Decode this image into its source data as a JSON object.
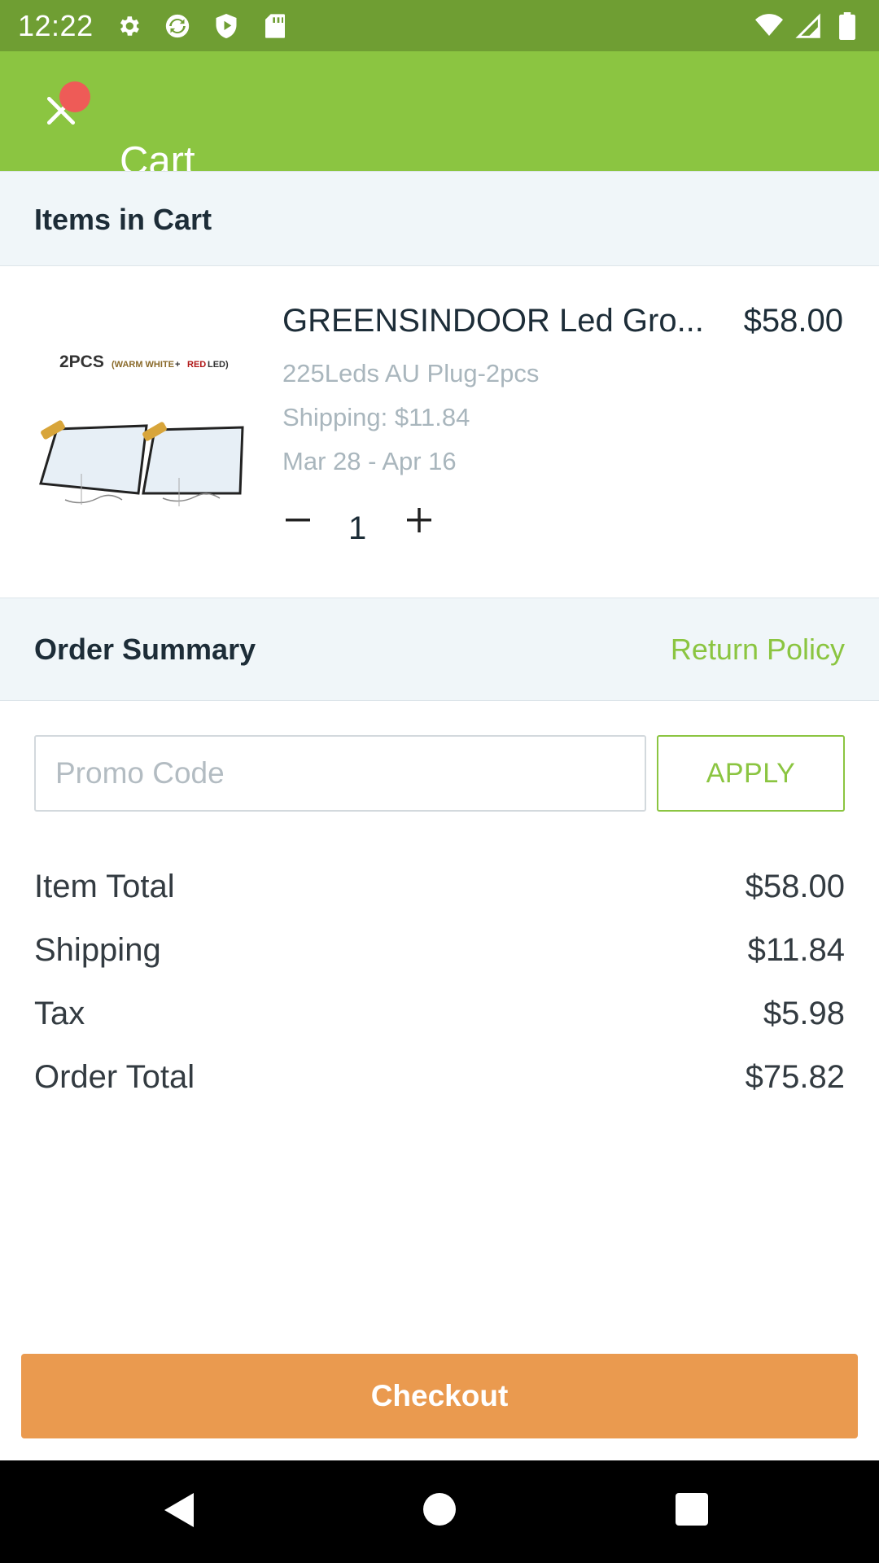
{
  "status_bar": {
    "time": "12:22",
    "left_icons": [
      "settings-icon",
      "sync-icon",
      "shield-icon",
      "sd-card-icon"
    ],
    "right_icons": [
      "wifi-icon",
      "signal-icon",
      "battery-icon"
    ]
  },
  "app_bar": {
    "title": "Cart",
    "close_icon": "close-icon"
  },
  "cart": {
    "section_title": "Items in Cart",
    "items": [
      {
        "name": "GREENSINDOOR Led Gro...",
        "price": "$58.00",
        "variant": "225Leds AU Plug-2pcs",
        "shipping": "Shipping: $11.84",
        "delivery": "Mar 28 - Apr 16",
        "quantity": "1",
        "image_caption_main": "2PCS",
        "image_caption_warm": "(WARM WHITE",
        "image_caption_plus": " + ",
        "image_caption_red": "RED",
        "image_caption_led": " LED)"
      }
    ]
  },
  "summary": {
    "title": "Order Summary",
    "return_policy": "Return Policy",
    "promo_placeholder": "Promo Code",
    "apply_label": "APPLY",
    "rows": [
      {
        "label": "Item Total",
        "value": "$58.00"
      },
      {
        "label": "Shipping",
        "value": "$11.84"
      },
      {
        "label": "Tax",
        "value": "$5.98"
      },
      {
        "label": "Order Total",
        "value": "$75.82"
      }
    ]
  },
  "checkout_label": "Checkout",
  "colors": {
    "app_bar": "#8bc541",
    "status_bar": "#6f9e33",
    "accent_green": "#8bc541",
    "checkout": "#ea9a4f",
    "badge": "#ee5b57"
  }
}
